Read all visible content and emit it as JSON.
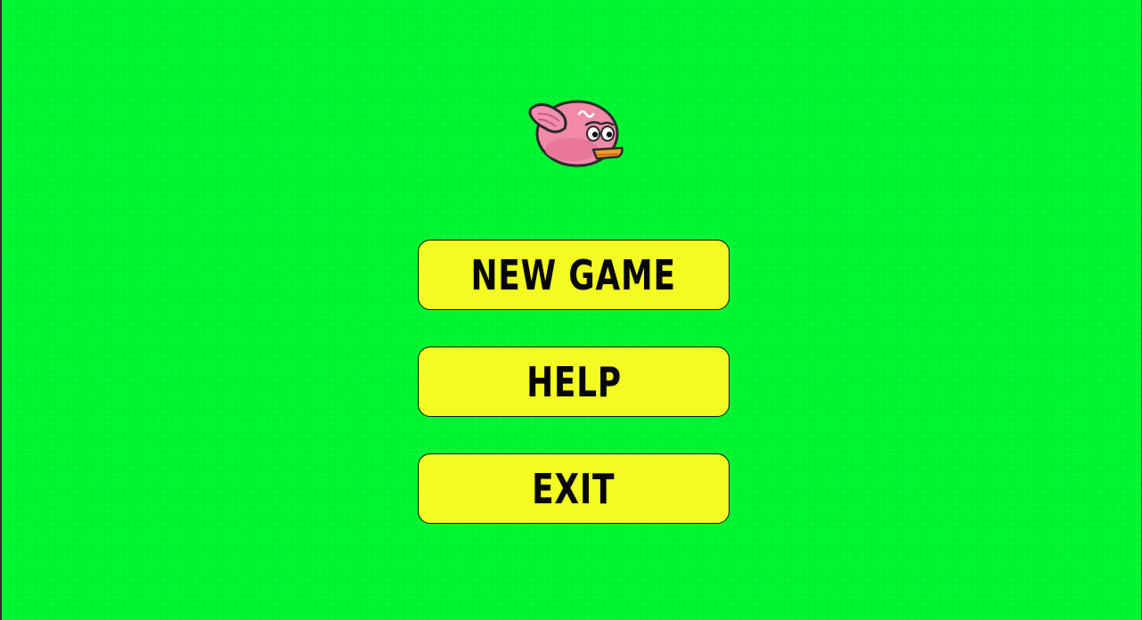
{
  "background": {
    "color": "#00f532"
  },
  "logo": {
    "icon": "pink-bird-icon",
    "color": "#f08aa8"
  },
  "menu": {
    "button_color": "#f3fb22",
    "items": [
      {
        "label": "NEW GAME"
      },
      {
        "label": "HELP"
      },
      {
        "label": "EXIT"
      }
    ]
  }
}
